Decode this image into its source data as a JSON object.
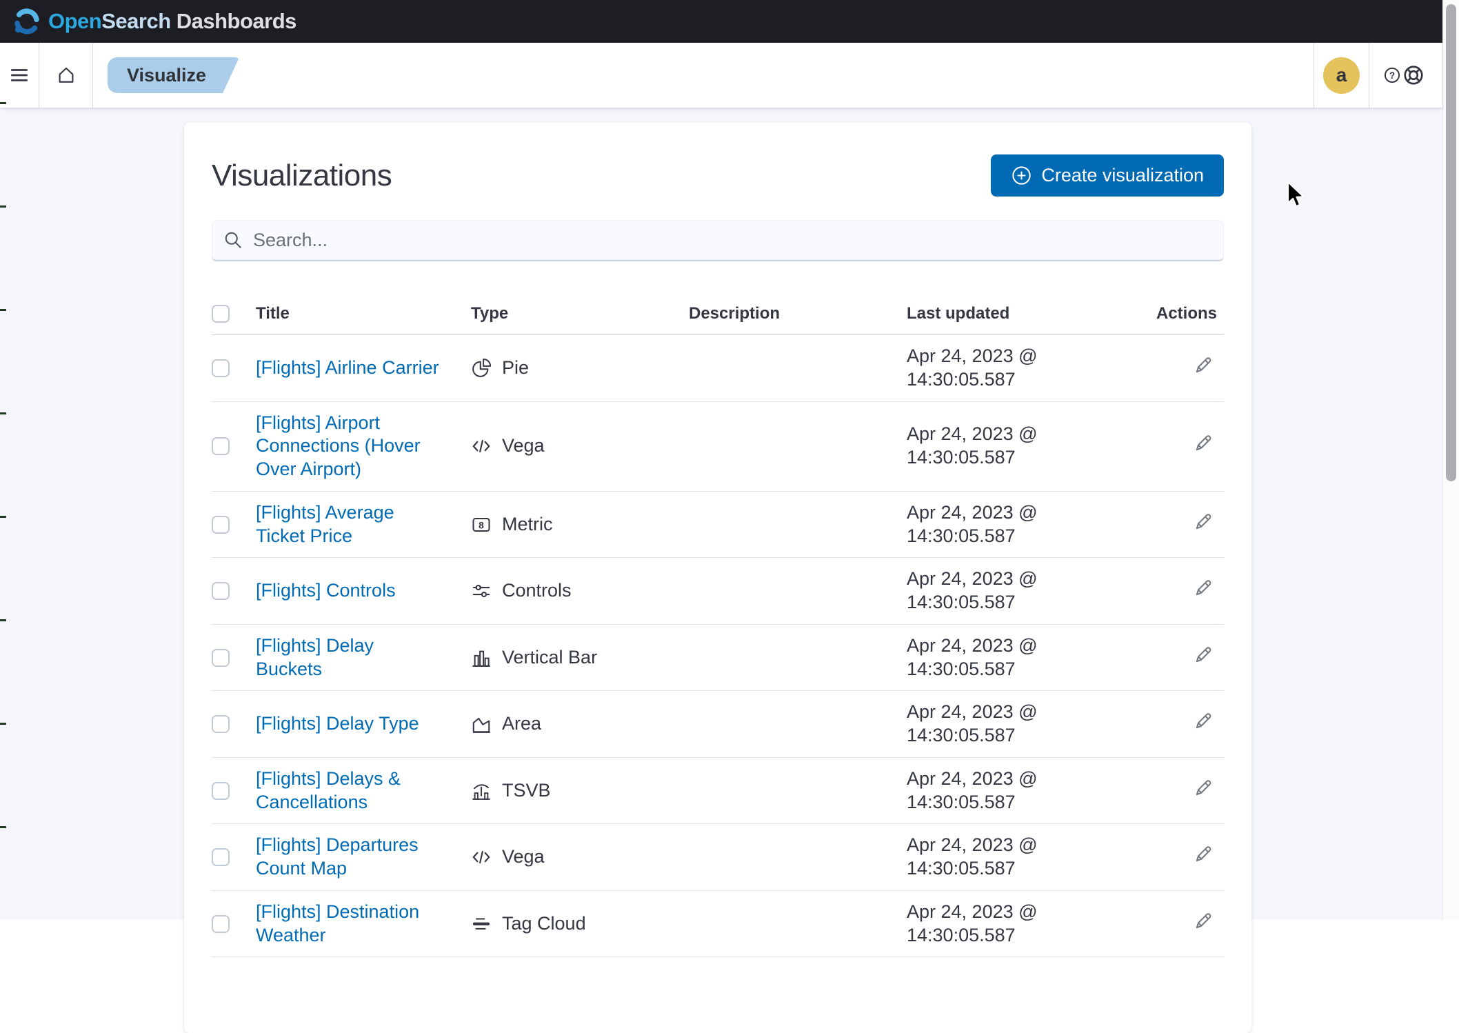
{
  "header": {
    "logo_open": "Open",
    "logo_search": "Search",
    "logo_dashboards": " Dashboards"
  },
  "navbar": {
    "breadcrumb": "Visualize"
  },
  "account": {
    "avatar_letter": "a"
  },
  "page": {
    "title": "Visualizations",
    "create_button": "Create visualization",
    "search_placeholder": "Search...",
    "table": {
      "headers": {
        "title": "Title",
        "type": "Type",
        "description": "Description",
        "last_updated": "Last updated",
        "actions": "Actions"
      },
      "rows": [
        {
          "title": "[Flights] Airline Carrier",
          "type": "Pie",
          "icon": "pie-chart-icon",
          "description": "",
          "last_updated": "Apr 24, 2023 @ 14:30:05.587"
        },
        {
          "title": "[Flights] Airport Connections (Hover Over Airport)",
          "type": "Vega",
          "icon": "vega-code-icon",
          "description": "",
          "last_updated": "Apr 24, 2023 @ 14:30:05.587"
        },
        {
          "title": "[Flights] Average Ticket Price",
          "type": "Metric",
          "icon": "metric-icon",
          "description": "",
          "last_updated": "Apr 24, 2023 @ 14:30:05.587"
        },
        {
          "title": "[Flights] Controls",
          "type": "Controls",
          "icon": "controls-icon",
          "description": "",
          "last_updated": "Apr 24, 2023 @ 14:30:05.587"
        },
        {
          "title": "[Flights] Delay Buckets",
          "type": "Vertical Bar",
          "icon": "vertical-bar-icon",
          "description": "",
          "last_updated": "Apr 24, 2023 @ 14:30:05.587"
        },
        {
          "title": "[Flights] Delay Type",
          "type": "Area",
          "icon": "area-chart-icon",
          "description": "",
          "last_updated": "Apr 24, 2023 @ 14:30:05.587"
        },
        {
          "title": "[Flights] Delays & Cancellations",
          "type": "TSVB",
          "icon": "tsvb-icon",
          "description": "",
          "last_updated": "Apr 24, 2023 @ 14:30:05.587"
        },
        {
          "title": "[Flights] Departures Count Map",
          "type": "Vega",
          "icon": "vega-code-icon",
          "description": "",
          "last_updated": "Apr 24, 2023 @ 14:30:05.587"
        },
        {
          "title": "[Flights] Destination Weather",
          "type": "Tag Cloud",
          "icon": "tag-cloud-icon",
          "description": "",
          "last_updated": "Apr 24, 2023 @ 14:30:05.587"
        }
      ]
    }
  },
  "colors": {
    "primary": "#006BB4",
    "header-bg": "#1D1E24",
    "breadcrumb-bg": "#ABCDE9",
    "avatar-bg": "#E5C35C",
    "logo-open": "#2CA8E0",
    "logo-search": "#C4DCF0",
    "logo-dash": "#DFE0E2"
  }
}
